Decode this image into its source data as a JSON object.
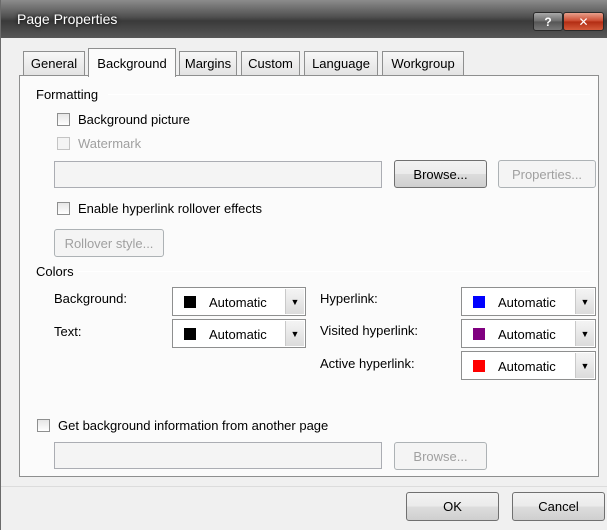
{
  "window": {
    "title": "Page Properties",
    "help_label": "?",
    "close_label": "✕"
  },
  "tabs": [
    {
      "label": "General"
    },
    {
      "label": "Background"
    },
    {
      "label": "Margins"
    },
    {
      "label": "Custom"
    },
    {
      "label": "Language"
    },
    {
      "label": "Workgroup"
    }
  ],
  "active_tab": "Background",
  "formatting": {
    "group_label": "Formatting",
    "background_picture_label": "Background picture",
    "watermark_label": "Watermark",
    "picture_path_value": "",
    "browse_label": "Browse...",
    "properties_label": "Properties...",
    "rollover_label": "Enable hyperlink rollover effects",
    "rollover_style_label": "Rollover style..."
  },
  "colors": {
    "group_label": "Colors",
    "background": {
      "label": "Background:",
      "value": "Automatic",
      "swatch": "#000000"
    },
    "text": {
      "label": "Text:",
      "value": "Automatic",
      "swatch": "#000000"
    },
    "hyperlink": {
      "label": "Hyperlink:",
      "value": "Automatic",
      "swatch": "#0000ff"
    },
    "visited_hyperlink": {
      "label": "Visited hyperlink:",
      "value": "Automatic",
      "swatch": "#800080"
    },
    "active_hyperlink": {
      "label": "Active hyperlink:",
      "value": "Automatic",
      "swatch": "#ff0000"
    }
  },
  "another_page": {
    "label": "Get background information from another page",
    "path_value": "",
    "browse_label": "Browse..."
  },
  "footer": {
    "ok_label": "OK",
    "cancel_label": "Cancel"
  }
}
